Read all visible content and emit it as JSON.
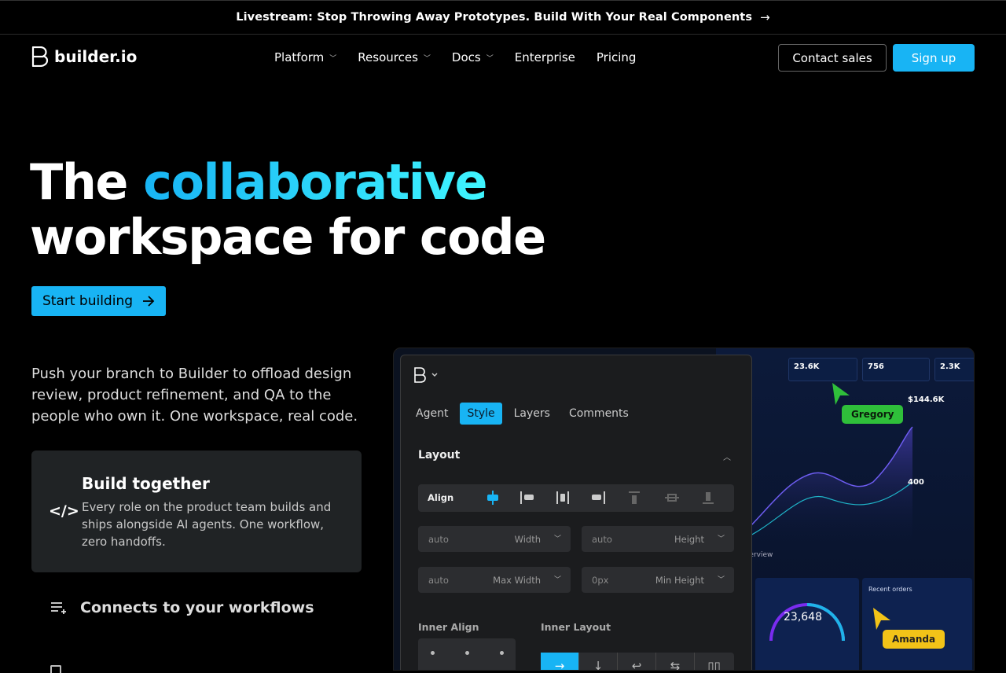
{
  "banner": {
    "text": "Livestream: Stop Throwing Away Prototypes. Build With Your Real Components",
    "arrow": "→"
  },
  "nav": {
    "logo": "builder.io",
    "items": [
      {
        "label": "Platform",
        "has_menu": true
      },
      {
        "label": "Resources",
        "has_menu": true
      },
      {
        "label": "Docs",
        "has_menu": true
      },
      {
        "label": "Enterprise",
        "has_menu": false
      },
      {
        "label": "Pricing",
        "has_menu": false
      }
    ],
    "contact_label": "Contact sales",
    "signup_label": "Sign up"
  },
  "hero": {
    "title_prefix": "The",
    "title_highlight": "collaborative",
    "title_line2": "workspace for code",
    "cta_label": "Start building",
    "intro": "Push your branch to Builder to offload design review, product refinement, and QA to the people who own it. One workspace, real code."
  },
  "features": [
    {
      "title": "Build together",
      "desc": "Every role on the product team builds and ships alongside AI agents. One workflow, zero handoffs.",
      "icon": "code-icon",
      "active": true
    },
    {
      "title": "Connects to your workflows",
      "icon": "list-add-icon",
      "active": false
    }
  ],
  "editor": {
    "tabs": [
      "Agent",
      "Style",
      "Layers",
      "Comments"
    ],
    "active_tab": "Style",
    "section": "Layout",
    "align_label": "Align",
    "fields": [
      {
        "value": "auto",
        "label": "Width"
      },
      {
        "value": "auto",
        "label": "Height"
      },
      {
        "value": "auto",
        "label": "Max Width"
      },
      {
        "value": "0px",
        "label": "Min Height"
      }
    ],
    "inner_align_label": "Inner Align",
    "inner_layout_label": "Inner Layout"
  },
  "dashboard": {
    "kpis": [
      "23.6K",
      "756",
      "2.3K"
    ],
    "revenue": "$144.6K",
    "sessions": "400",
    "gauge_value": "23,648",
    "recent_orders_label": "Recent orders",
    "overview_label": "Overview"
  },
  "collaborators": [
    {
      "name": "Gregory",
      "color": "#2fbf3a"
    },
    {
      "name": "Amanda",
      "color": "#f2c318"
    }
  ],
  "colors": {
    "accent": "#18b4f4",
    "accent_light": "#3ff5ff",
    "background": "#000000"
  }
}
